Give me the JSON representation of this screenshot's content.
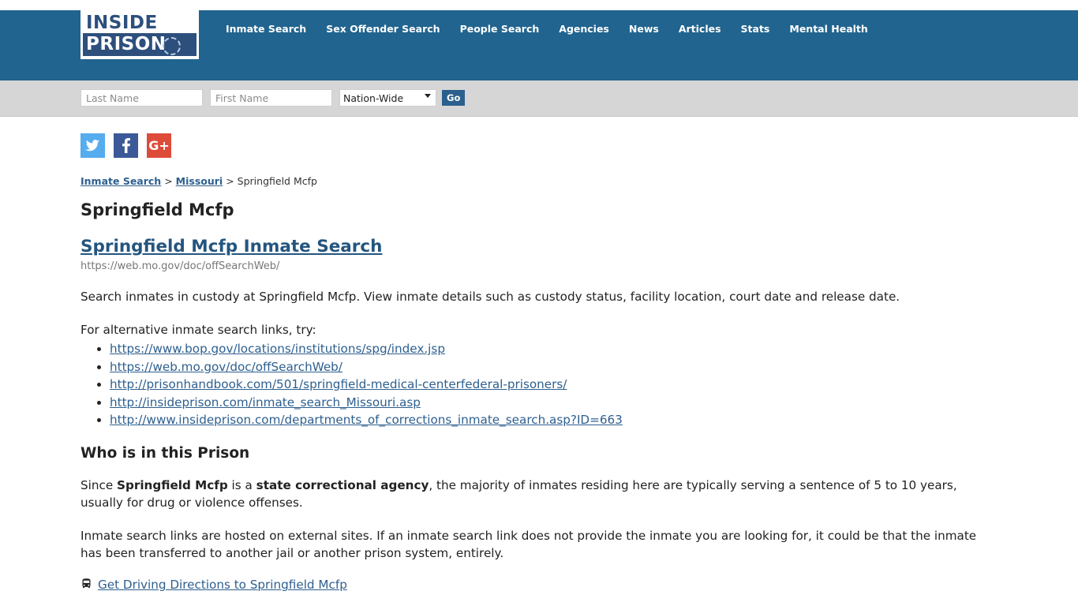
{
  "header": {
    "logo": {
      "line1": "INSIDE",
      "line2": "PRISON",
      "ring_icon": "barbed-wire-circle-icon"
    },
    "nav": [
      {
        "label": "Inmate Search"
      },
      {
        "label": "Sex Offender Search"
      },
      {
        "label": "People Search"
      },
      {
        "label": "Agencies"
      },
      {
        "label": "News"
      },
      {
        "label": "Articles"
      },
      {
        "label": "Stats"
      },
      {
        "label": "Mental Health"
      }
    ],
    "bg_color": "#21648f"
  },
  "search": {
    "last_name_placeholder": "Last Name",
    "last_name_value": "",
    "first_name_placeholder": "First Name",
    "first_name_value": "",
    "region_selected": "Nation-Wide",
    "region_options": [
      "Nation-Wide"
    ],
    "go_label": "Go",
    "go_color": "#2b5f8e",
    "bar_color": "#d6d6d6"
  },
  "social": [
    {
      "name": "twitter",
      "glyph": "🐦",
      "color": "#55acee"
    },
    {
      "name": "facebook",
      "glyph": "f",
      "color": "#3b5998"
    },
    {
      "name": "google-plus",
      "glyph": "G+",
      "color": "#dd4b39"
    }
  ],
  "breadcrumb": {
    "items": [
      {
        "label": "Inmate Search",
        "link": true
      },
      {
        "label": "Missouri",
        "link": true
      },
      {
        "label": "Springfield Mcfp",
        "link": false
      }
    ],
    "separator": ">"
  },
  "main": {
    "page_title": "Springfield Mcfp",
    "result_link_text": "Springfield Mcfp Inmate Search",
    "result_url": "https://web.mo.gov/doc/offSearchWeb/",
    "description": "Search inmates in custody at Springfield Mcfp. View inmate details such as custody status, facility location, court date and release date.",
    "alt_intro": "For alternative inmate search links, try:",
    "alt_links": [
      "https://www.bop.gov/locations/institutions/spg/index.jsp",
      "https://web.mo.gov/doc/offSearchWeb/",
      "http://prisonhandbook.com/501/springfield-medical-centerfederal-prisoners/",
      "http://insideprison.com/inmate_search_Missouri.asp",
      "http://www.insideprison.com/departments_of_corrections_inmate_search.asp?ID=663"
    ],
    "section_title": "Who is in this Prison",
    "who_para": {
      "p1": "Since ",
      "b1": "Springfield Mcfp",
      "p2": " is a ",
      "b2": "state correctional agency",
      "p3": ", the majority of inmates residing here are typically serving a sentence of 5 to 10 years, usually for drug or violence offenses."
    },
    "hosted_note": "Inmate search links are hosted on external sites. If an inmate search link does not provide the inmate you are looking for, it could be that the inmate has been transferred to another jail or another prison system, entirely.",
    "directions_label": "Get Driving Directions to Springfield Mcfp",
    "directions_icon": "bus-icon",
    "link_color": "#2d5f8f"
  }
}
